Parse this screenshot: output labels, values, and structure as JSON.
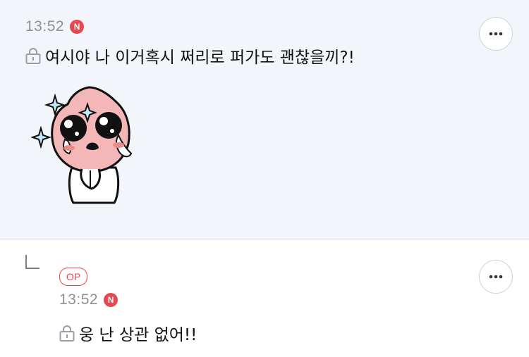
{
  "post": {
    "time": "13:52",
    "new_badge": "N",
    "message": "여시야 나 이거혹시 쩌리로 퍼가도 괜찮을끼?!",
    "sticker_icon": "peach-character-crying-sticker"
  },
  "reply": {
    "author_badge": "OP",
    "time": "13:52",
    "new_badge": "N",
    "message": "웅 난 상관 없어!!"
  },
  "colors": {
    "post_background": "#f2f5fa",
    "accent_red": "#e5484d",
    "meta_gray": "#8c8f95"
  }
}
